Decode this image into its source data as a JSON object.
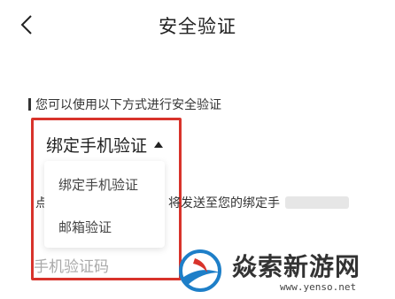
{
  "header": {
    "title": "安全验证",
    "back_icon": "chevron-left-icon"
  },
  "hint": {
    "text": "您可以使用以下方式进行安全验证"
  },
  "method_selector": {
    "current": "绑定手机验证",
    "options": [
      "绑定手机验证",
      "邮箱验证"
    ],
    "highlight_color": "#d8332b"
  },
  "send_tip": {
    "left_fragment": "点",
    "text": "将发送至您的绑定手"
  },
  "code_field": {
    "placeholder": "手机验证码"
  },
  "watermark": {
    "brand": "焱索新游网",
    "url": "www.yenso.net"
  }
}
